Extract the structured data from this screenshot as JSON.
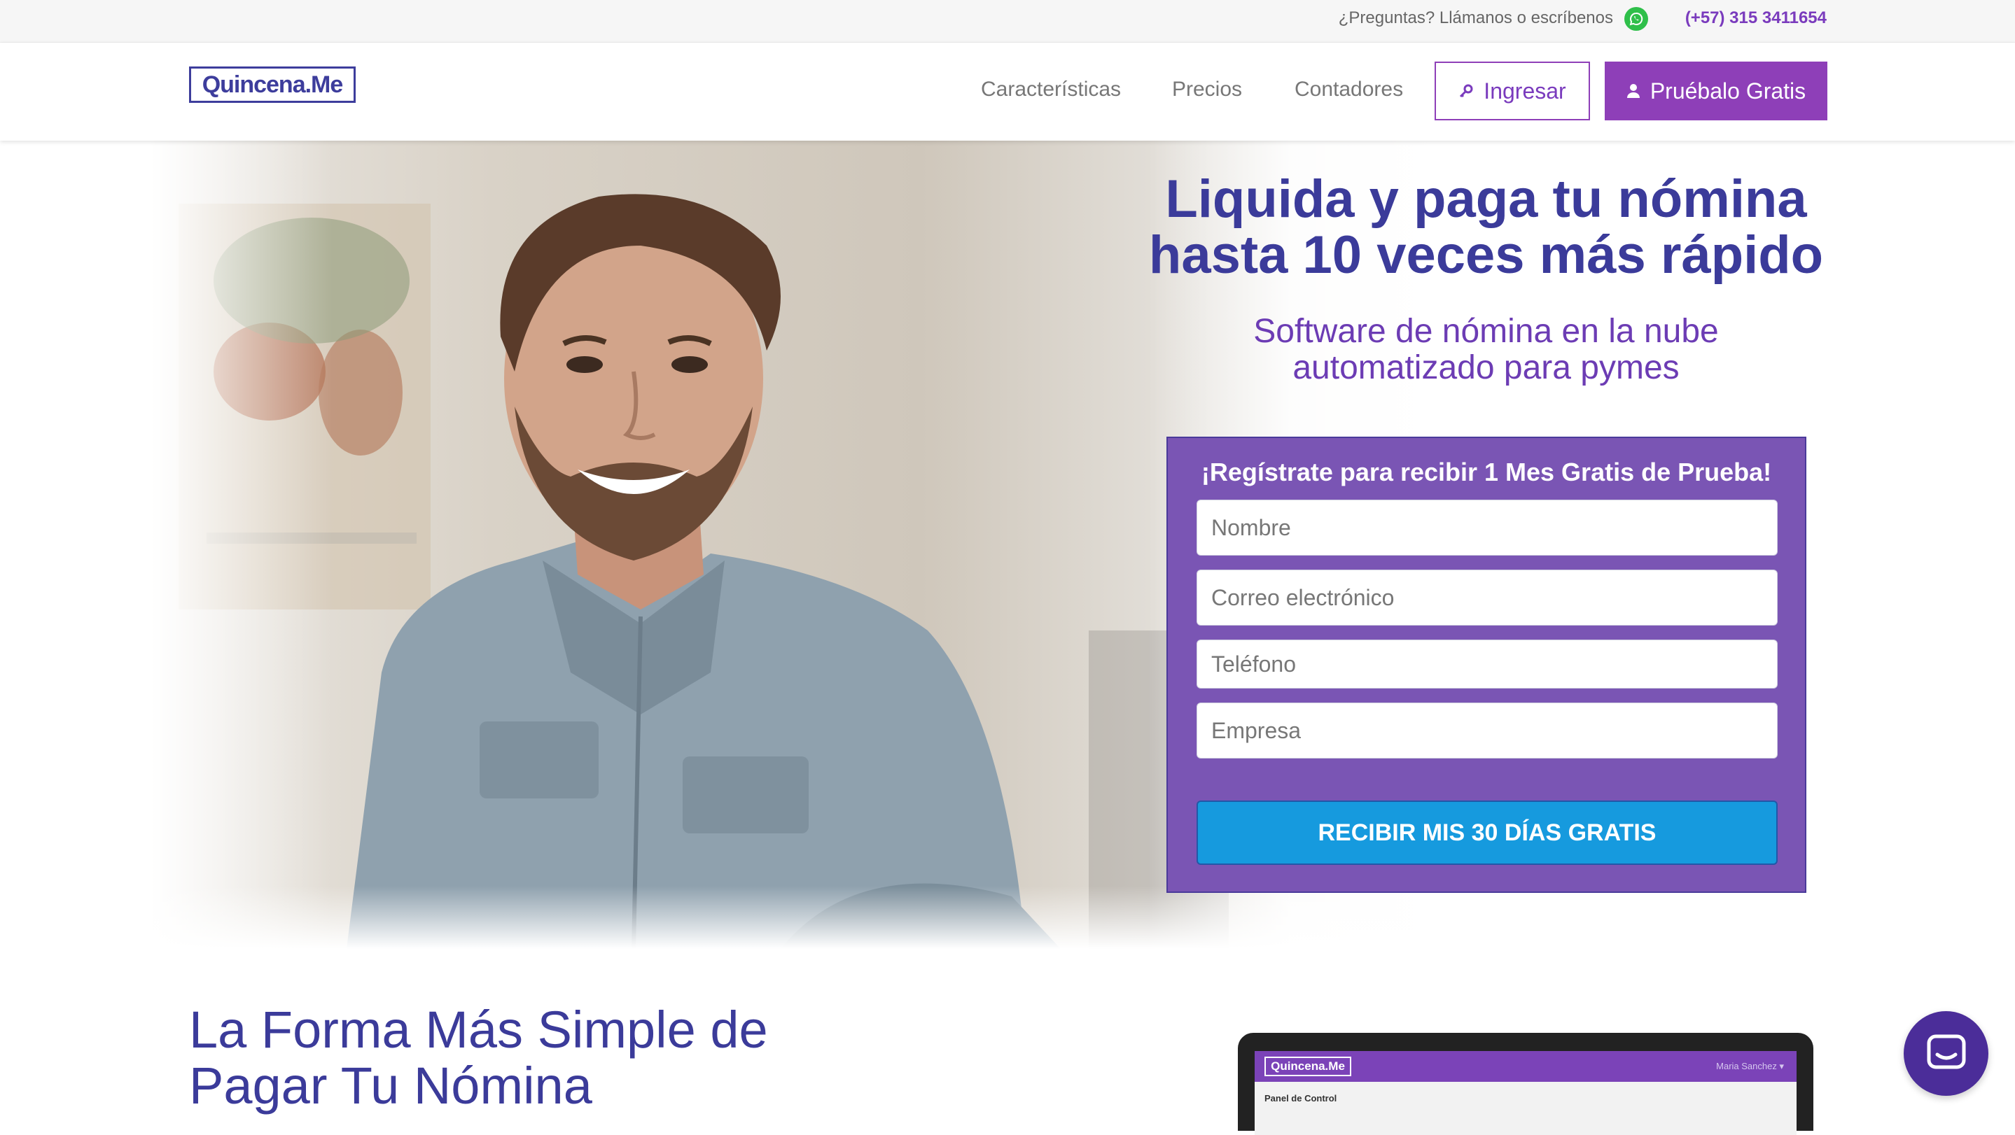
{
  "topbar": {
    "question": "¿Preguntas? Llámanos o escríbenos",
    "phone": "(+57) 315 3411654",
    "whatsapp_icon": "whatsapp-icon"
  },
  "header": {
    "logo": "Quincena.Me",
    "nav": [
      "Características",
      "Precios",
      "Contadores"
    ],
    "login_label": "Ingresar",
    "trial_label": "Pruébalo Gratis"
  },
  "hero": {
    "title": "Liquida y paga tu nómina hasta 10 veces más rápido",
    "subtitle": "Software de nómina en la nube automatizado para pymes"
  },
  "signup": {
    "title": "¡Regístrate para recibir 1 Mes Gratis de Prueba!",
    "placeholders": {
      "name": "Nombre",
      "email": "Correo electrónico",
      "phone": "Teléfono",
      "company": "Empresa"
    },
    "cta": "RECIBIR MIS 30 DÍAS GRATIS"
  },
  "section": {
    "title": "La Forma Más Simple de Pagar Tu Nómina"
  },
  "laptop": {
    "logo": "Quincena.Me",
    "user": "Maria Sanchez ▾",
    "side": "Panel de Control"
  },
  "colors": {
    "brand_purple": "#8e3fb8",
    "title_blue": "#3b3b9a",
    "form_bg": "#7a55b4",
    "cta_blue": "#169ade",
    "chat_bg": "#4b2d99"
  }
}
